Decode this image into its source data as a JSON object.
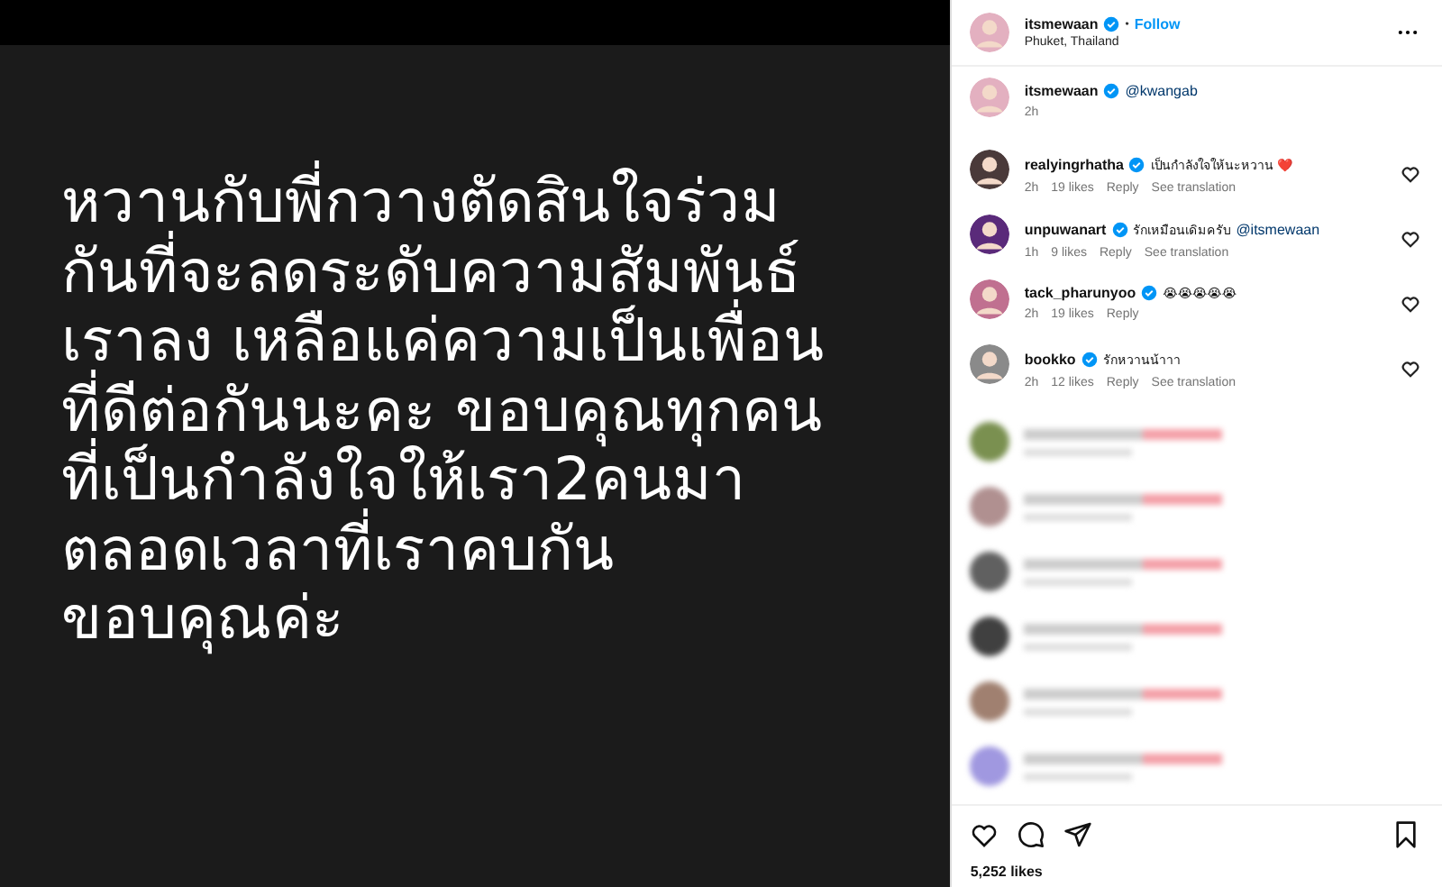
{
  "post": {
    "caption_lines": [
      "หวานกับพี่กวางตัดสินใจร่วม",
      "กันที่จะลดระดับความสัมพันธ์",
      "เราลง เหลือแค่ความเป็นเพื่อน",
      "ที่ดีต่อกันนะคะ ขอบคุณทุกคน",
      "ที่เป็นกำลังใจให้เรา2คนมา",
      "ตลอดเวลาที่เราคบกัน",
      "ขอบคุณค่ะ"
    ]
  },
  "header": {
    "username": "itsmewaan",
    "verified": true,
    "separator": "•",
    "follow": "Follow",
    "location": "Phuket, Thailand"
  },
  "caption": {
    "username": "itsmewaan",
    "verified": true,
    "mention": "@kwangab",
    "time": "2h"
  },
  "comments": [
    {
      "kind": "comment",
      "username": "realyingrhatha",
      "verified": true,
      "text": "เป็นกำลังใจให้นะหวาน ❤️",
      "time": "2h",
      "likes": "19 likes",
      "reply": "Reply",
      "translation": "See translation"
    },
    {
      "kind": "comment",
      "username": "unpuwanart",
      "verified": true,
      "text": "รักเหมือนเดิมครับ",
      "mention": "@itsmewaan",
      "time": "1h",
      "likes": "9 likes",
      "reply": "Reply",
      "translation": "See translation"
    },
    {
      "kind": "comment",
      "username": "tack_pharunyoo",
      "verified": true,
      "text": "😭😭😭😭😭",
      "time": "2h",
      "likes": "19 likes",
      "reply": "Reply"
    },
    {
      "kind": "comment",
      "username": "bookko",
      "verified": true,
      "text": "รักหวานน้าาา",
      "time": "2h",
      "likes": "12 likes",
      "reply": "Reply",
      "translation": "See translation"
    },
    {
      "kind": "blurred"
    },
    {
      "kind": "blurred"
    },
    {
      "kind": "blurred"
    },
    {
      "kind": "blurred"
    },
    {
      "kind": "blurred"
    },
    {
      "kind": "blurred"
    }
  ],
  "footer": {
    "likes": "5,252 likes"
  }
}
